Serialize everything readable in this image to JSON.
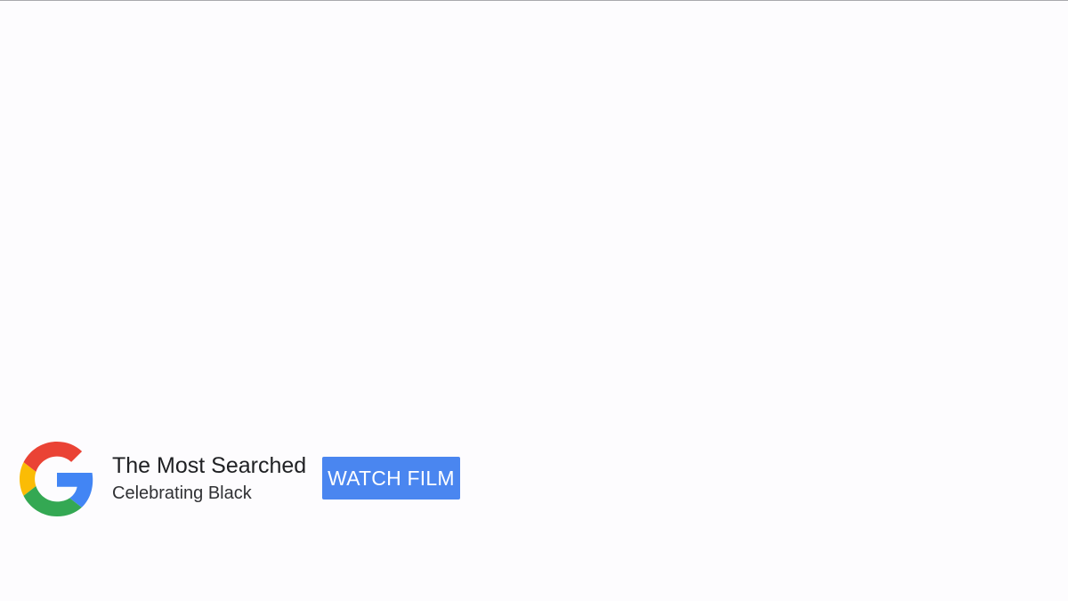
{
  "ad": {
    "logo_icon": "google-g-logo",
    "title": "The Most Searched",
    "subtitle": "Celebrating Black",
    "cta_label": "WATCH FILM"
  },
  "colors": {
    "background": "#fdfcfe",
    "button": "#4a86f0",
    "google_blue": "#4285F4",
    "google_red": "#EA4335",
    "google_yellow": "#FBBC05",
    "google_green": "#34A853"
  }
}
